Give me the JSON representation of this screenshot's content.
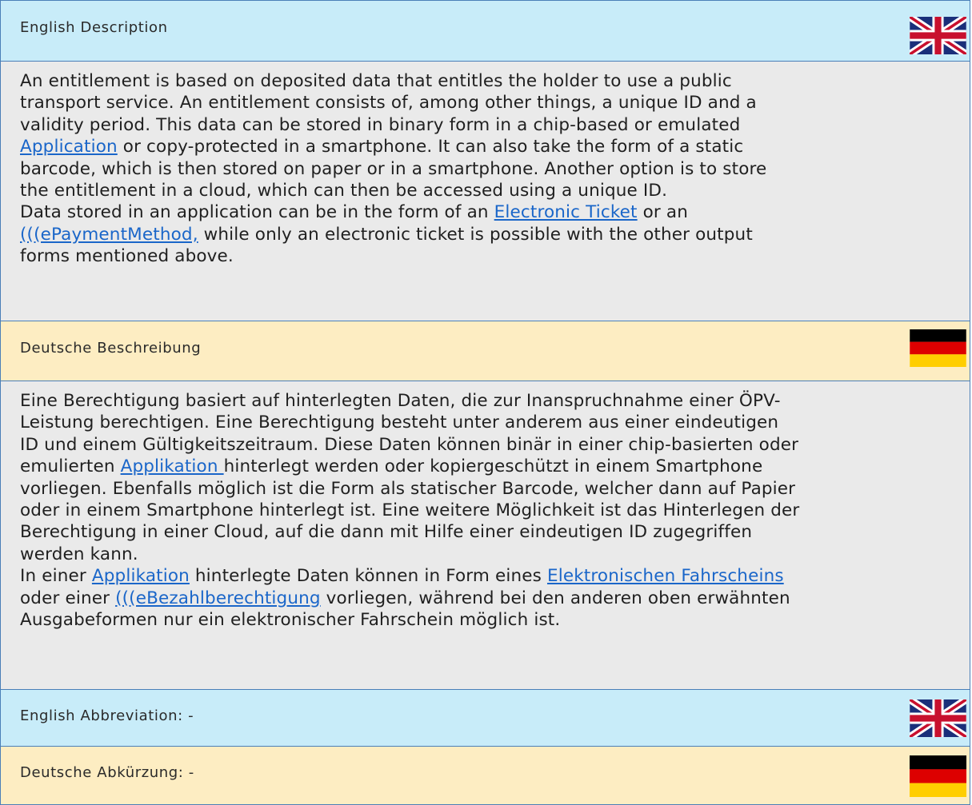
{
  "english_description": {
    "heading": "English Description",
    "paragraph_1": [
      [
        {
          "t": "An entitlement is based on deposited data that entitles the holder to use a public"
        }
      ],
      [
        {
          "t": "transport service. An entitlement consists of, among other things, a unique ID and a"
        }
      ],
      [
        {
          "t": "validity period. This data can be stored in binary form in a chip-based or emulated"
        }
      ],
      [
        {
          "t": "Application",
          "link": true
        },
        {
          "t": " or copy-protected in a smartphone. It can also take the form of a static"
        }
      ],
      [
        {
          "t": "barcode, which is then stored on paper or in a smartphone. Another option is to store"
        }
      ],
      [
        {
          "t": "the entitlement in a cloud, which can then be accessed using a unique ID."
        }
      ]
    ],
    "paragraph_2": [
      [
        {
          "t": "Data stored in an application can be in the form of an "
        },
        {
          "t": "Electronic Ticket",
          "link": true
        },
        {
          "t": " or an"
        }
      ],
      [
        {
          "t": "(((ePaymentMethod,",
          "link": true
        },
        {
          "t": " while only an electronic ticket is possible with the other output"
        }
      ],
      [
        {
          "t": "forms mentioned above."
        }
      ]
    ]
  },
  "deutsche_beschreibung": {
    "heading": "Deutsche Beschreibung",
    "paragraph_1": [
      [
        {
          "t": "Eine Berechtigung basiert auf hinterlegten Daten, die zur Inanspruchnahme einer ÖPV-"
        }
      ],
      [
        {
          "t": "Leistung berechtigen. Eine Berechtigung besteht unter anderem aus einer eindeutigen"
        }
      ],
      [
        {
          "t": "ID und einem Gültigkeitszeitraum. Diese Daten können binär in einer chip-basierten oder"
        }
      ],
      [
        {
          "t": "emulierten "
        },
        {
          "t": "Applikation ",
          "link": true
        },
        {
          "t": "hinterlegt werden oder kopiergeschützt in einem Smartphone"
        }
      ],
      [
        {
          "t": "vorliegen. Ebenfalls möglich ist die Form als statischer Barcode, welcher dann auf Papier"
        }
      ],
      [
        {
          "t": "oder in einem Smartphone hinterlegt ist. Eine weitere Möglichkeit ist das Hinterlegen der"
        }
      ],
      [
        {
          "t": "Berechtigung in einer Cloud, auf die dann mit Hilfe einer eindeutigen ID zugegriffen"
        }
      ],
      [
        {
          "t": "werden kann."
        }
      ]
    ],
    "paragraph_2": [
      [
        {
          "t": "In einer "
        },
        {
          "t": "Applikation",
          "link": true
        },
        {
          "t": " hinterlegte Daten können in Form eines "
        },
        {
          "t": "Elektronischen Fahrscheins",
          "link": true
        }
      ],
      [
        {
          "t": "oder einer "
        },
        {
          "t": "(((eBezahlberechtigung",
          "link": true
        },
        {
          "t": " vorliegen, während bei den anderen oben erwähnten"
        }
      ],
      [
        {
          "t": "Ausgabeformen nur ein elektronischer Fahrschein möglich ist."
        }
      ]
    ]
  },
  "english_abbreviation": {
    "label": "English Abbreviation: -"
  },
  "deutsche_abkuerzung": {
    "label": "Deutsche Abkürzung: -"
  },
  "colors": {
    "header_english_bg": "#c8ecf9",
    "header_german_bg": "#fdedc2",
    "body_bg": "#eaeaea",
    "border": "#4a7fb8",
    "link": "#1a66c9"
  },
  "icons": [
    "uk-flag-icon",
    "german-flag-icon"
  ]
}
